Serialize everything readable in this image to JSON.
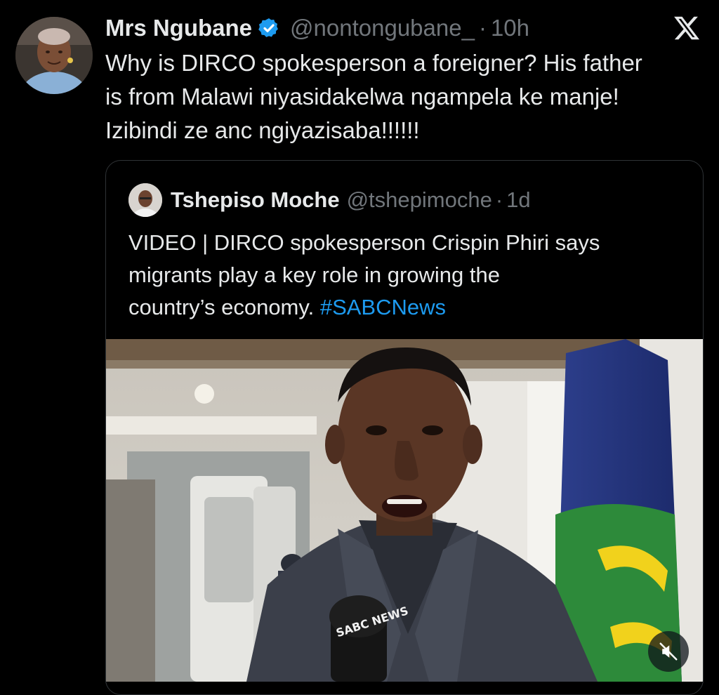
{
  "tweet": {
    "author_name": "Mrs Ngubane",
    "handle": "@nontongubane_",
    "separator": "·",
    "time": "10h",
    "text_lines": [
      "Why is DIRCO spokesperson a foreigner? His father",
      "is from Malawi niyasidakelwa ngampela ke manje!",
      "Izibindi ze anc ngiyazisaba!!!!!!"
    ],
    "icons": {
      "verified": "verified-badge-icon",
      "logo": "x-logo-icon"
    }
  },
  "quote": {
    "author_name": "Tshepiso Moche",
    "handle": "@tshepimoche",
    "separator": "·",
    "time": "1d",
    "text_lines": [
      "VIDEO | DIRCO spokesperson Crispin Phiri says",
      "migrants play a key role in growing the",
      "country’s economy."
    ],
    "hashtag": "#SABCNews",
    "video": {
      "watermark": "SABC NEWS",
      "mute_icon": "muted-speaker-icon"
    }
  },
  "colors": {
    "background": "#000000",
    "primary_text": "#e7e9ea",
    "secondary_text": "#71767b",
    "link": "#1d9bf0",
    "verified": "#1d9bf0",
    "card_border": "#2f3336"
  }
}
